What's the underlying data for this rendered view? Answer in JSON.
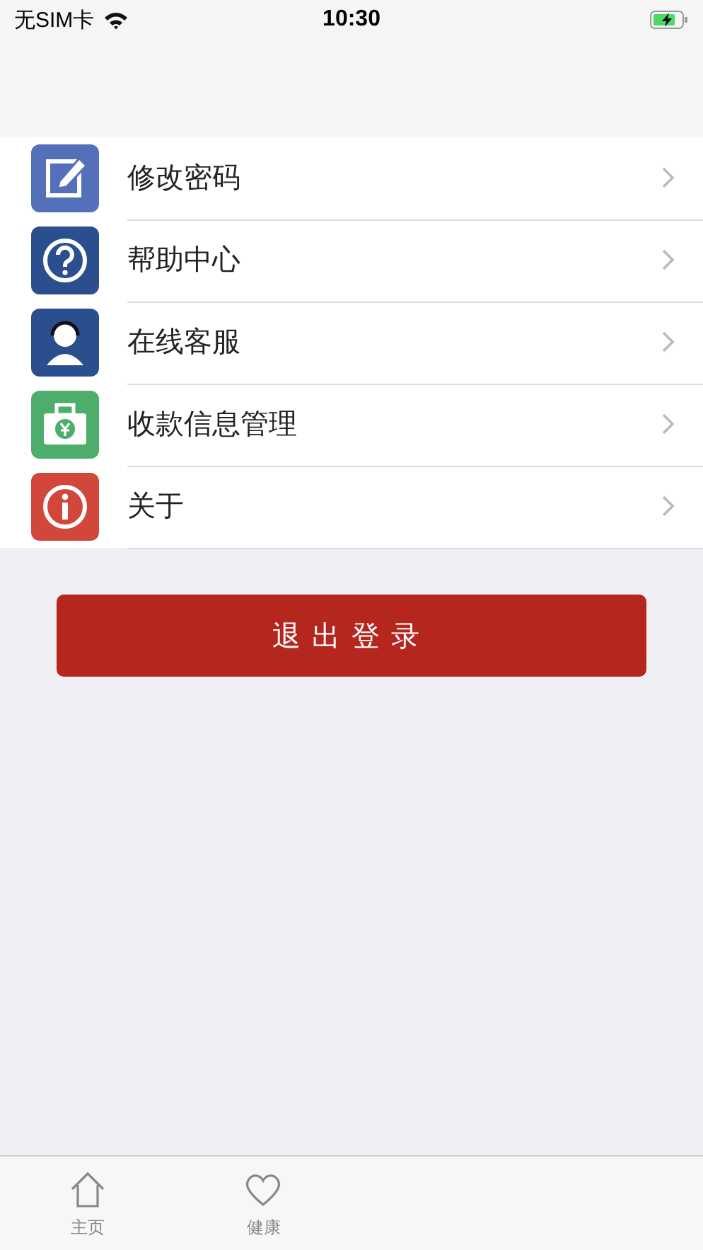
{
  "status_bar": {
    "carrier": "无SIM卡",
    "time": "10:30"
  },
  "menu": [
    {
      "kind": "edit",
      "label": "修改密码"
    },
    {
      "kind": "help",
      "label": "帮助中心"
    },
    {
      "kind": "service",
      "label": "在线客服"
    },
    {
      "kind": "payment",
      "label": "收款信息管理"
    },
    {
      "kind": "info",
      "label": "关于"
    }
  ],
  "logout_button": "退出登录",
  "tabs": [
    {
      "kind": "home",
      "label": "主页"
    },
    {
      "kind": "health",
      "label": "健康"
    }
  ]
}
